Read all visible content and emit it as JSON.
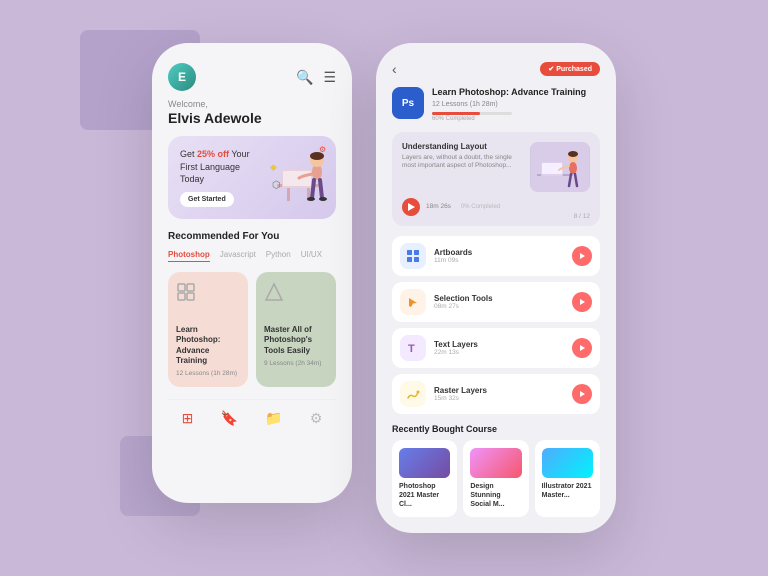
{
  "background": {
    "color": "#c9b8d8"
  },
  "phone1": {
    "header": {
      "welcome": "Welcome,",
      "user": "Elvis Adewole"
    },
    "banner": {
      "line1": "Get",
      "highlight": "25% off",
      "line2": "Your First Language Today",
      "button": "Get Started"
    },
    "section": "Recommended For You",
    "tabs": [
      "Photoshop",
      "Javascript",
      "Python",
      "UI/UX"
    ],
    "active_tab": "Photoshop",
    "cards": [
      {
        "title": "Learn Photoshop: Advance Training",
        "lessons": "12 Lessons (1h 28m)",
        "color": "#f5ddd5"
      },
      {
        "title": "Master All of Photoshop's Tools Easily",
        "lessons": "9 Lessons (2h 34m)",
        "color": "#c8d5c0"
      }
    ],
    "nav": [
      "grid",
      "bookmark",
      "folder",
      "settings"
    ]
  },
  "phone2": {
    "back": "‹",
    "purchased_badge": "✔ Purchased",
    "course": {
      "icon": "Ps",
      "title": "Learn Photoshop: Advance Training",
      "meta": "12 Lessons (1h 28m)",
      "progress": 60,
      "progress_text": "60% Completed"
    },
    "preview": {
      "title": "Understanding Layout",
      "description": "Layers are, without a doubt, the single most important aspect of Photoshop...",
      "duration": "18m 26s",
      "progress_text": "0% Completed",
      "counter": "8 / 12"
    },
    "lessons": [
      {
        "name": "Artboards",
        "time": "11m 09s",
        "icon": "⊞",
        "iconClass": "lesson-icon-blue"
      },
      {
        "name": "Selection Tools",
        "time": "08m 27s",
        "icon": "↗",
        "iconClass": "lesson-icon-orange"
      },
      {
        "name": "Text Layers",
        "time": "22m 13s",
        "icon": "T",
        "iconClass": "lesson-icon-purple"
      },
      {
        "name": "Raster Layers",
        "time": "15m 32s",
        "icon": "✏",
        "iconClass": "lesson-icon-yellow"
      }
    ],
    "recently_bought": {
      "title": "Recently Bought Course",
      "items": [
        {
          "name": "Photoshop 2021 Master Cl..."
        },
        {
          "name": "Design Stunning Social M..."
        },
        {
          "name": "Illustrator 2021 Master..."
        }
      ]
    }
  }
}
